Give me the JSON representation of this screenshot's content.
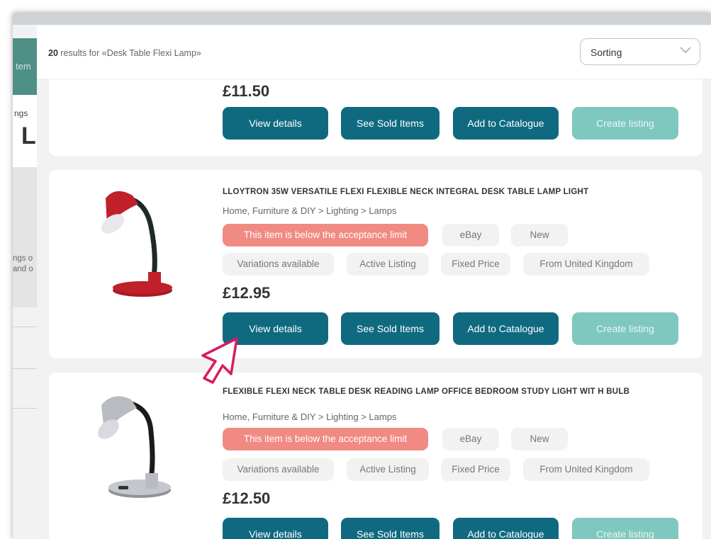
{
  "background": {
    "tab_fragment": "tem",
    "label_fragment": "ngs",
    "big_letter": "L",
    "text_fragment_1": "ngs o",
    "text_fragment_2": "and o"
  },
  "header": {
    "count": "20",
    "results_text": "results for «Desk Table Flexi Lamp»",
    "sort_label": "Sorting"
  },
  "buttons": {
    "view": "View details",
    "sold": "See Sold Items",
    "catalogue": "Add to Catalogue",
    "create": "Create listing"
  },
  "products": [
    {
      "price": "£11.50"
    },
    {
      "title": "LLOYTRON 35W VERSATILE FLEXI FLEXIBLE NECK INTEGRAL DESK TABLE LAMP LIGHT",
      "category": "Home, Furniture & DIY > Lighting > Lamps",
      "warning": "This item is below the acceptance limit",
      "marketplace": "eBay",
      "condition": "New",
      "variations": "Variations available",
      "status": "Active Listing",
      "format": "Fixed Price",
      "location": "From United Kingdom",
      "price": "£12.95",
      "image_icon": "red-desk-lamp",
      "image_color": "#c0202a"
    },
    {
      "title": "FLEXIBLE FLEXI NECK TABLE DESK READING LAMP OFFICE BEDROOM STUDY LIGHT WIT H BULB",
      "category": "Home, Furniture & DIY > Lighting > Lamps",
      "warning": "This item is below the acceptance limit",
      "marketplace": "eBay",
      "condition": "New",
      "variations": "Variations available",
      "status": "Active Listing",
      "format": "Fixed Price",
      "location": "From United Kingdom",
      "price": "£12.50",
      "image_icon": "silver-desk-lamp",
      "image_color": "#b8bcc0"
    }
  ],
  "colors": {
    "primary_button": "#0f6a80",
    "disabled_button": "#7ec8bf",
    "warning_chip": "#f08a82",
    "pointer": "#d81b60"
  }
}
